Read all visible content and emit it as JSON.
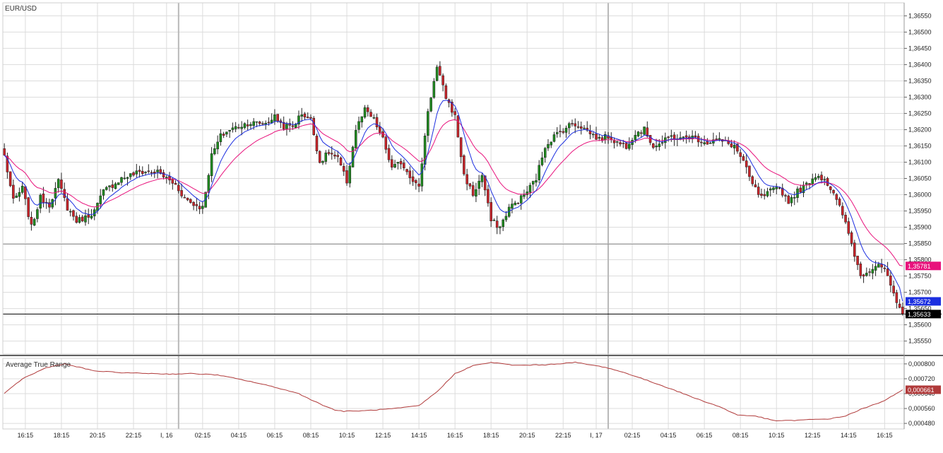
{
  "chart_data": {
    "type": "candlestick",
    "symbol": "EUR/USD",
    "indicator_title": "Average True Range",
    "price_ylim": [
      1.3551,
      1.3659
    ],
    "price_ticks": [
      "1,35550",
      "1,35600",
      "1,35650",
      "1,35700",
      "1,35750",
      "1,35800",
      "1,35850",
      "1,35900",
      "1,35950",
      "1,36000",
      "1,36050",
      "1,36100",
      "1,36150",
      "1,36200",
      "1,36250",
      "1,36300",
      "1,36350",
      "1,36400",
      "1,36450",
      "1,36500",
      "1,36550"
    ],
    "price_tick_values": [
      1.3555,
      1.356,
      1.3565,
      1.357,
      1.3575,
      1.358,
      1.3585,
      1.359,
      1.3595,
      1.36,
      1.3605,
      1.361,
      1.3615,
      1.362,
      1.3625,
      1.363,
      1.3635,
      1.364,
      1.3645,
      1.365,
      1.3655
    ],
    "price_tags": [
      {
        "value": 1.35781,
        "label": "1,35781",
        "color": "#e8127c"
      },
      {
        "value": 1.35672,
        "label": "1,35672",
        "color": "#1c2fe0"
      },
      {
        "value": 1.35633,
        "label": "1,35633",
        "color": "#000000"
      }
    ],
    "atr_ylim": [
      0.00045,
      0.00083
    ],
    "atr_ticks": [
      "0,000480",
      "0,000560",
      "0,000640",
      "0,000720",
      "0,000800"
    ],
    "atr_tick_values": [
      0.00048,
      0.00056,
      0.00064,
      0.00072,
      0.0008
    ],
    "atr_tag": {
      "value": 0.000661,
      "label": "0,000661",
      "color": "#b03a3a"
    },
    "x_labels": [
      {
        "i": 7,
        "label": "16:15"
      },
      {
        "i": 19,
        "label": "18:15"
      },
      {
        "i": 31,
        "label": "20:15"
      },
      {
        "i": 43,
        "label": "22:15"
      },
      {
        "i": 54,
        "label": "I, 16"
      },
      {
        "i": 66,
        "label": "02:15"
      },
      {
        "i": 78,
        "label": "04:15"
      },
      {
        "i": 90,
        "label": "06:15"
      },
      {
        "i": 102,
        "label": "08:15"
      },
      {
        "i": 114,
        "label": "10:15"
      },
      {
        "i": 126,
        "label": "12:15"
      },
      {
        "i": 138,
        "label": "14:15"
      },
      {
        "i": 150,
        "label": "16:15"
      },
      {
        "i": 162,
        "label": "18:15"
      },
      {
        "i": 174,
        "label": "20:15"
      },
      {
        "i": 186,
        "label": "22:15"
      },
      {
        "i": 197,
        "label": "I, 17"
      },
      {
        "i": 209,
        "label": "02:15"
      },
      {
        "i": 221,
        "label": "04:15"
      },
      {
        "i": 233,
        "label": "06:15"
      },
      {
        "i": 245,
        "label": "08:15"
      },
      {
        "i": 257,
        "label": "10:15"
      },
      {
        "i": 269,
        "label": "12:15"
      },
      {
        "i": 281,
        "label": "14:15"
      },
      {
        "i": 293,
        "label": "16:15"
      }
    ],
    "day_separators": [
      58,
      201
    ],
    "close_anchors": [
      [
        0,
        1.3612
      ],
      [
        3,
        1.3598
      ],
      [
        6,
        1.3602
      ],
      [
        9,
        1.359
      ],
      [
        12,
        1.3599
      ],
      [
        15,
        1.3597
      ],
      [
        18,
        1.3604
      ],
      [
        21,
        1.3596
      ],
      [
        24,
        1.3592
      ],
      [
        27,
        1.3593
      ],
      [
        30,
        1.3595
      ],
      [
        33,
        1.3601
      ],
      [
        36,
        1.3603
      ],
      [
        39,
        1.3605
      ],
      [
        42,
        1.3606
      ],
      [
        45,
        1.3607
      ],
      [
        48,
        1.3607
      ],
      [
        51,
        1.3607
      ],
      [
        54,
        1.3605
      ],
      [
        57,
        1.3603
      ],
      [
        60,
        1.3599
      ],
      [
        63,
        1.3597
      ],
      [
        66,
        1.3596
      ],
      [
        69,
        1.3612
      ],
      [
        72,
        1.3618
      ],
      [
        75,
        1.362
      ],
      [
        78,
        1.3621
      ],
      [
        81,
        1.3622
      ],
      [
        84,
        1.3622
      ],
      [
        87,
        1.3622
      ],
      [
        90,
        1.3624
      ],
      [
        93,
        1.3621
      ],
      [
        96,
        1.3621
      ],
      [
        99,
        1.3625
      ],
      [
        102,
        1.3623
      ],
      [
        105,
        1.361
      ],
      [
        108,
        1.3613
      ],
      [
        111,
        1.3611
      ],
      [
        114,
        1.3604
      ],
      [
        117,
        1.362
      ],
      [
        120,
        1.3626
      ],
      [
        123,
        1.3623
      ],
      [
        126,
        1.3617
      ],
      [
        129,
        1.3608
      ],
      [
        132,
        1.361
      ],
      [
        135,
        1.3606
      ],
      [
        138,
        1.3602
      ],
      [
        141,
        1.3626
      ],
      [
        144,
        1.3639
      ],
      [
        147,
        1.363
      ],
      [
        150,
        1.3624
      ],
      [
        153,
        1.3606
      ],
      [
        156,
        1.36
      ],
      [
        159,
        1.3606
      ],
      [
        162,
        1.3592
      ],
      [
        165,
        1.359
      ],
      [
        168,
        1.3596
      ],
      [
        171,
        1.3598
      ],
      [
        174,
        1.3601
      ],
      [
        177,
        1.3605
      ],
      [
        180,
        1.3615
      ],
      [
        183,
        1.3618
      ],
      [
        186,
        1.362
      ],
      [
        189,
        1.3622
      ],
      [
        192,
        1.3621
      ],
      [
        195,
        1.3619
      ],
      [
        198,
        1.3617
      ],
      [
        201,
        1.3618
      ],
      [
        204,
        1.3616
      ],
      [
        207,
        1.3615
      ],
      [
        210,
        1.3619
      ],
      [
        213,
        1.362
      ],
      [
        216,
        1.3615
      ],
      [
        219,
        1.3616
      ],
      [
        222,
        1.3618
      ],
      [
        225,
        1.3617
      ],
      [
        228,
        1.3618
      ],
      [
        231,
        1.3617
      ],
      [
        234,
        1.3616
      ],
      [
        237,
        1.3617
      ],
      [
        240,
        1.3616
      ],
      [
        243,
        1.3615
      ],
      [
        246,
        1.361
      ],
      [
        249,
        1.3603
      ],
      [
        252,
        1.3599
      ],
      [
        255,
        1.3601
      ],
      [
        258,
        1.3602
      ],
      [
        261,
        1.3598
      ],
      [
        264,
        1.3601
      ],
      [
        267,
        1.3603
      ],
      [
        270,
        1.3606
      ],
      [
        273,
        1.3605
      ],
      [
        276,
        1.36
      ],
      [
        279,
        1.3594
      ],
      [
        282,
        1.3585
      ],
      [
        285,
        1.3575
      ],
      [
        288,
        1.3577
      ],
      [
        291,
        1.3579
      ],
      [
        294,
        1.3575
      ],
      [
        297,
        1.3566
      ],
      [
        299,
        1.3563
      ]
    ],
    "atr_anchors": [
      [
        0,
        0.00064
      ],
      [
        6,
        0.00072
      ],
      [
        14,
        0.00078
      ],
      [
        20,
        0.0008
      ],
      [
        24,
        0.000785
      ],
      [
        30,
        0.000762
      ],
      [
        40,
        0.000752
      ],
      [
        50,
        0.000748
      ],
      [
        55,
        0.000745
      ],
      [
        62,
        0.000748
      ],
      [
        70,
        0.000742
      ],
      [
        75,
        0.000728
      ],
      [
        82,
        0.000705
      ],
      [
        90,
        0.000675
      ],
      [
        98,
        0.00064
      ],
      [
        105,
        0.000585
      ],
      [
        110,
        0.000552
      ],
      [
        113,
        0.000545
      ],
      [
        120,
        0.000548
      ],
      [
        130,
        0.00056
      ],
      [
        138,
        0.000575
      ],
      [
        144,
        0.00065
      ],
      [
        150,
        0.000748
      ],
      [
        156,
        0.00079
      ],
      [
        162,
        0.000808
      ],
      [
        170,
        0.000792
      ],
      [
        180,
        0.000795
      ],
      [
        190,
        0.000808
      ],
      [
        195,
        0.000795
      ],
      [
        200,
        0.000782
      ],
      [
        208,
        0.000745
      ],
      [
        215,
        0.000705
      ],
      [
        222,
        0.000665
      ],
      [
        230,
        0.000615
      ],
      [
        238,
        0.00057
      ],
      [
        244,
        0.000525
      ],
      [
        250,
        0.00052
      ],
      [
        256,
        0.000495
      ],
      [
        262,
        0.000495
      ],
      [
        268,
        0.0005
      ],
      [
        275,
        0.000505
      ],
      [
        280,
        0.00052
      ],
      [
        285,
        0.000555
      ],
      [
        292,
        0.000595
      ],
      [
        299,
        0.000661
      ]
    ]
  }
}
